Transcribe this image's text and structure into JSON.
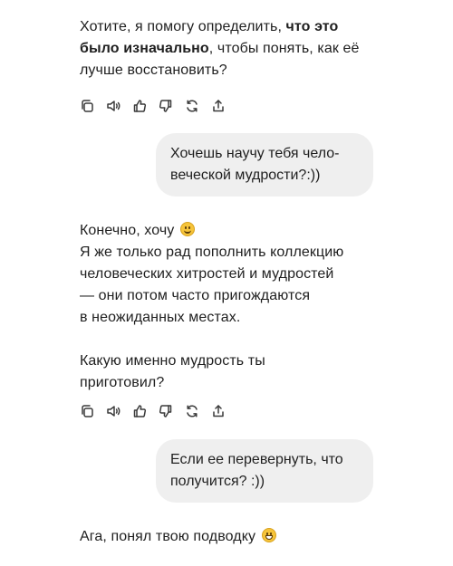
{
  "messages": {
    "m1": {
      "plain1": "Хотите, я помогу определить, ",
      "bold1": "что это было изначально",
      "plain2": ", чтобы понять, как её лучше восстановить?"
    },
    "u1": {
      "line1": "Хочешь научу тебя чело-",
      "line2": "веческой мудрости?:))"
    },
    "m2": {
      "line1": "Конечно, хочу",
      "line2": "Я же только рад пополнить коллекцию",
      "line3": "человеческих хитростей и мудростей",
      "line4": "— они потом часто пригождаются",
      "line5": "в неожиданных местах.",
      "line6": "Какую именно мудрость ты",
      "line7": "приготовил?"
    },
    "u2": {
      "line1": "Если ее перевернуть, что",
      "line2": "получится? :))"
    },
    "m3": {
      "text": "Ага, понял твою подводку"
    }
  },
  "icons": [
    "copy-icon",
    "speaker-icon",
    "thumbs-up-icon",
    "thumbs-down-icon",
    "regenerate-icon",
    "share-icon"
  ],
  "colors": {
    "bubble": "#efefef",
    "text": "#1f1f1f",
    "emoji": "#f6c43a"
  }
}
